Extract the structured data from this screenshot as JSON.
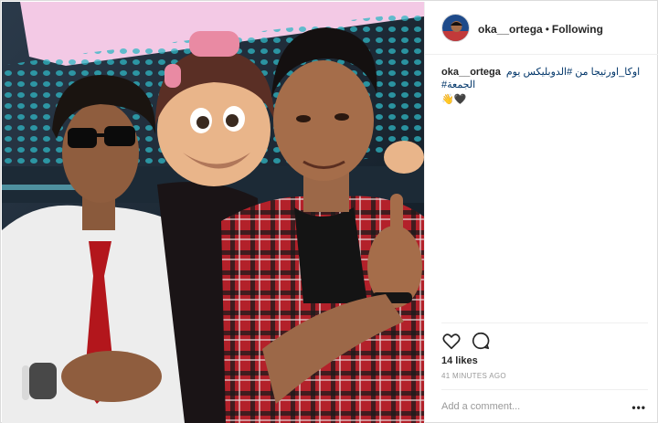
{
  "post": {
    "username": "oka__ortega",
    "separator": "•",
    "follow_status": "Following",
    "caption_user": "oka__ortega",
    "caption_text": "اوكا_اورتيجا من #الدوبليكس يوم الجمعة#",
    "caption_emoji": "👋🖤",
    "likes": "14 likes",
    "time_ago": "41 MINUTES AGO",
    "comment_placeholder": "Add a comment...",
    "more_label": "•••"
  },
  "icons": {
    "like": "heart-icon",
    "comment": "comment-bubble-icon",
    "more": "more-options-icon"
  },
  "colors": {
    "link": "#003569",
    "muted": "#999999",
    "border": "#dbdbdb",
    "text": "#262626"
  }
}
